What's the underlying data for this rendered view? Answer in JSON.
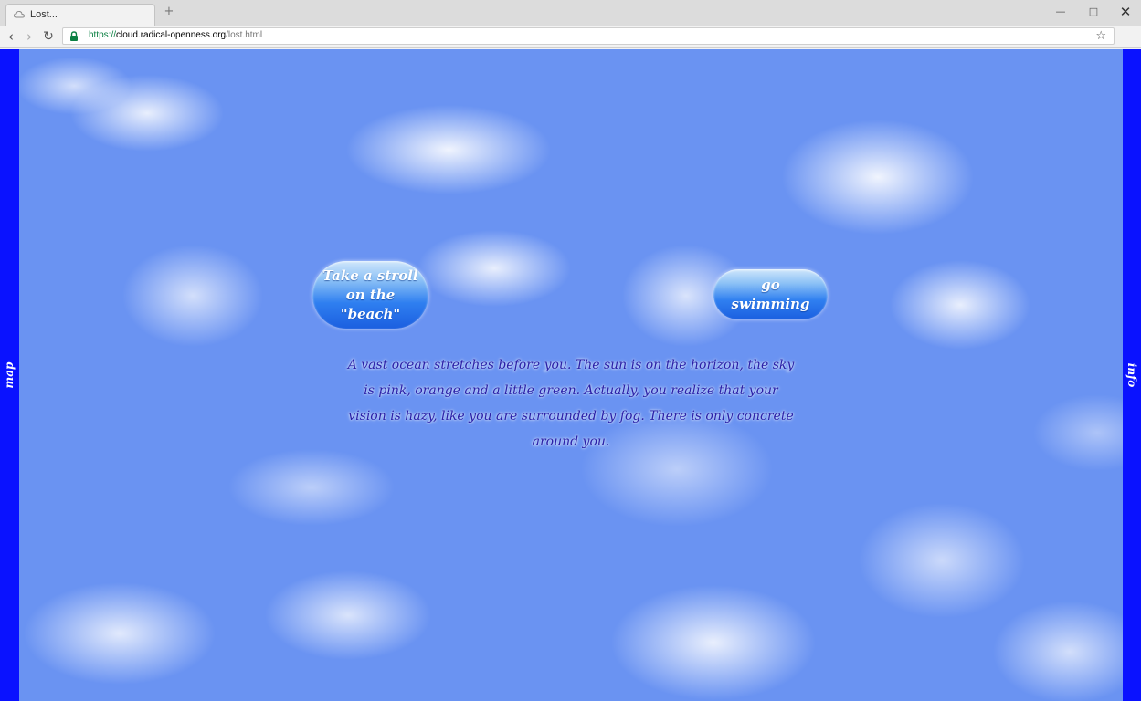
{
  "browser": {
    "tab_title": "Lost...",
    "new_tab_label": "+",
    "url_scheme": "https://",
    "url_host": "cloud.radical-openness.org",
    "url_path": "/lost.html",
    "icons": {
      "back": "back-arrow-icon",
      "forward": "forward-arrow-icon",
      "reload": "reload-icon",
      "lock": "lock-icon",
      "star": "bookmark-star-icon",
      "menu": "menu-icon",
      "favicon": "cloud-icon"
    },
    "colors": {
      "secure_green": "#0b8043"
    }
  },
  "page": {
    "side_left_label": "map",
    "side_right_label": "info",
    "choice_beach": "Take a stroll on the \"beach\"",
    "choice_swim": "go swimming",
    "story": "A vast ocean stretches before you. The sun is on the horizon, the sky is pink, orange and a little green. Actually, you realize that your vision is hazy, like you are surrounded by fog. There is only concrete around you.",
    "colors": {
      "sky": "#6a93f2",
      "side_bars": "#0a12ff",
      "story_text": "#2a20a8"
    }
  }
}
